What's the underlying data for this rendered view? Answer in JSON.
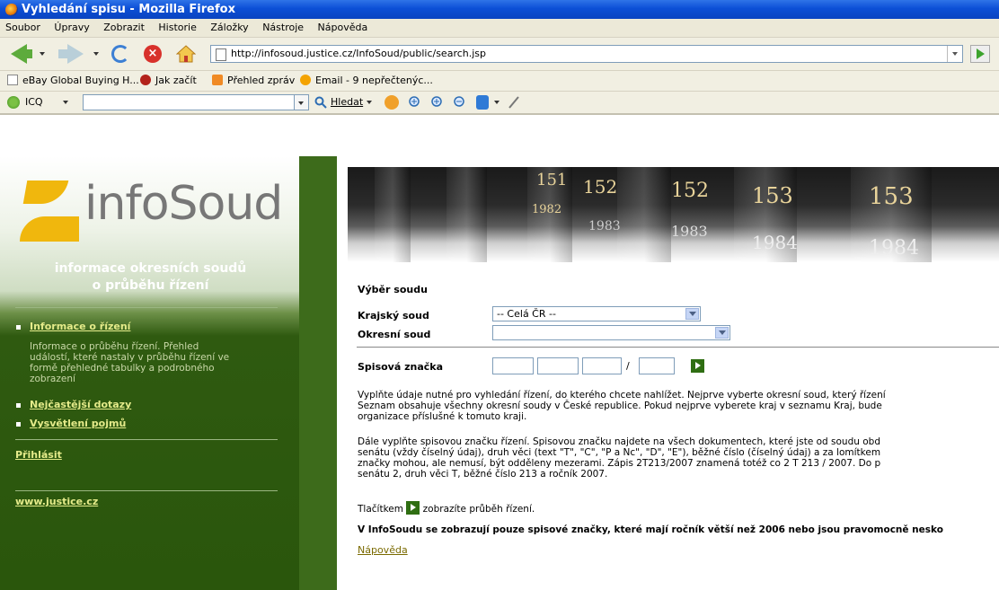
{
  "window": {
    "title": "Vyhledání spisu - Mozilla Firefox"
  },
  "menu": [
    "Soubor",
    "Úpravy",
    "Zobrazit",
    "Historie",
    "Záložky",
    "Nástroje",
    "Nápověda"
  ],
  "address": {
    "url": "http://infosoud.justice.cz/InfoSoud/public/search.jsp"
  },
  "bookmarks": [
    {
      "label": "eBay Global Buying H...",
      "icon": "page-icon"
    },
    {
      "label": "Jak začít",
      "icon": "firefox-bookmark-icon"
    },
    {
      "label": "Přehled zpráv",
      "icon": "rss-icon"
    },
    {
      "label": "Email - 9 nepřečtenýc...",
      "icon": "email-icon"
    }
  ],
  "toolbar3": {
    "icq_label": "ICQ",
    "search_label": "Hledat"
  },
  "sidebar": {
    "logo_text": "infoSoud",
    "tagline_line1": "informace okresních soudů",
    "tagline_line2": "o průběhu řízení",
    "items": [
      {
        "label": "Informace o řízení",
        "desc_lines": [
          "Informace o průběhu řízení. Přehled",
          "událostí, které nastaly v průběhu řízení ve",
          "formě přehledné tabulky a podrobného",
          "zobrazení"
        ]
      },
      {
        "label": "Nejčastější dotazy"
      },
      {
        "label": "Vysvětlení pojmů"
      }
    ],
    "login": "Přihlásit",
    "external_link": "www.justice.cz"
  },
  "banner": {
    "volumes": [
      "151",
      "152",
      "152",
      "153",
      "153",
      "1982",
      "1983",
      "1983",
      "1984",
      "1984"
    ]
  },
  "form": {
    "section_title": "Výběr soudu",
    "krajsky_label": "Krajský soud",
    "krajsky_value": "-- Celá ČR --",
    "okresni_label": "Okresní soud",
    "okresni_value": "",
    "spisova_label": "Spisová značka",
    "separator": "/"
  },
  "instructions": {
    "p1": [
      "Vyplňte údaje nutné pro vyhledání řízení, do kterého chcete nahlížet. Nejprve vyberte okresní soud, který řízení",
      "Seznam obsahuje všechny okresní soudy v České republice. Pokud nejprve vyberete kraj v seznamu Kraj, bude",
      "organizace příslušné k tomuto kraji."
    ],
    "p2": [
      "Dále vyplňte spisovou značku řízení. Spisovou značku najdete na všech dokumentech, které jste od soudu obd",
      "senátu (vždy číselný údaj), druh věci (text \"T\", \"C\", \"P a Nc\", \"D\", \"E\"), běžné číslo (číselný údaj) a za lomítkem",
      "značky mohou, ale nemusí, být odděleny mezerami. Zápis 2T213/2007 znamená totéž co 2 T 213 / 2007. Do p",
      "senátu 2, druh věci T, běžné číslo 213 a ročník 2007."
    ],
    "p3_before": "Tlačítkem",
    "p3_after": "zobrazíte průběh řízení.",
    "p4": "V InfoSoudu se zobrazují pouze spisové značky, které mají ročník větší než 2006 nebo jsou pravomocně nesko",
    "help_link": "Nápověda"
  }
}
